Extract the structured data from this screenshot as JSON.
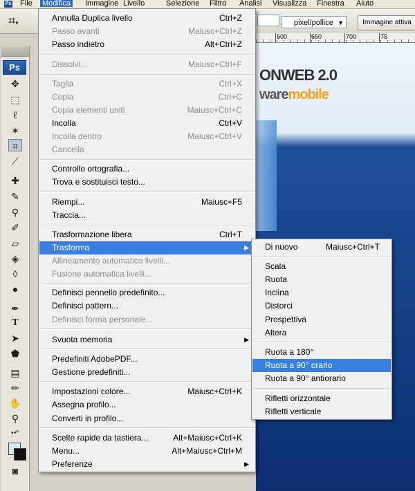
{
  "menubar": {
    "items": [
      "File",
      "Modifica",
      "Immagine",
      "Livello",
      "Selezione",
      "Filtro",
      "Analisi",
      "Visualizza",
      "Finestra",
      "Aiuto"
    ],
    "active_index": 1
  },
  "options_bar": {
    "unit_select_value": "pixel/pollice",
    "front_image_button": "Immagine attiva"
  },
  "ruler": {
    "ticks": [
      "600",
      "650",
      "700",
      "75"
    ]
  },
  "toolbox": {
    "logo": "Ps"
  },
  "canvas": {
    "brand_line1": "ONWEB 2.0",
    "brand_line2_a": "ware",
    "brand_line2_b": "mobile"
  },
  "edit_menu": {
    "items": [
      {
        "label": "Annulla Duplica livello",
        "shortcut": "Ctrl+Z",
        "enabled": true
      },
      {
        "label": "Passo avanti",
        "shortcut": "Maiusc+Ctrl+Z",
        "enabled": false
      },
      {
        "label": "Passo indietro",
        "shortcut": "Alt+Ctrl+Z",
        "enabled": true
      },
      {
        "label": "Dissolvi...",
        "shortcut": "Maiusc+Ctrl+F",
        "enabled": false
      },
      {
        "label": "Taglia",
        "shortcut": "Ctrl+X",
        "enabled": false
      },
      {
        "label": "Copia",
        "shortcut": "Ctrl+C",
        "enabled": false
      },
      {
        "label": "Copia elementi uniti",
        "shortcut": "Maiusc+Ctrl+C",
        "enabled": false
      },
      {
        "label": "Incolla",
        "shortcut": "Ctrl+V",
        "enabled": true
      },
      {
        "label": "Incolla dentro",
        "shortcut": "Maiusc+Ctrl+V",
        "enabled": false
      },
      {
        "label": "Cancella",
        "shortcut": "",
        "enabled": false
      },
      {
        "label": "Controllo ortografia...",
        "shortcut": "",
        "enabled": true
      },
      {
        "label": "Trova e sostituisci testo...",
        "shortcut": "",
        "enabled": true
      },
      {
        "label": "Riempi...",
        "shortcut": "Maiusc+F5",
        "enabled": true
      },
      {
        "label": "Traccia...",
        "shortcut": "",
        "enabled": true
      },
      {
        "label": "Trasformazione libera",
        "shortcut": "Ctrl+T",
        "enabled": true
      },
      {
        "label": "Trasforma",
        "shortcut": "",
        "enabled": true,
        "submenu": true,
        "highlighted": true
      },
      {
        "label": "Allineamento automatico livelli...",
        "shortcut": "",
        "enabled": false
      },
      {
        "label": "Fusione automatica livelli...",
        "shortcut": "",
        "enabled": false
      },
      {
        "label": "Definisci pennello predefinito...",
        "shortcut": "",
        "enabled": true
      },
      {
        "label": "Definisci pattern...",
        "shortcut": "",
        "enabled": true
      },
      {
        "label": "Definisci forma personale...",
        "shortcut": "",
        "enabled": false
      },
      {
        "label": "Svuota memoria",
        "shortcut": "",
        "enabled": true,
        "submenu": true
      },
      {
        "label": "Predefiniti AdobePDF...",
        "shortcut": "",
        "enabled": true
      },
      {
        "label": "Gestione predefiniti...",
        "shortcut": "",
        "enabled": true
      },
      {
        "label": "Impostazioni colore...",
        "shortcut": "Maiusc+Ctrl+K",
        "enabled": true
      },
      {
        "label": "Assegna profilo...",
        "shortcut": "",
        "enabled": true
      },
      {
        "label": "Converti in profilo...",
        "shortcut": "",
        "enabled": true
      },
      {
        "label": "Scelte rapide da tastiera...",
        "shortcut": "Alt+Maiusc+Ctrl+K",
        "enabled": true
      },
      {
        "label": "Menu...",
        "shortcut": "Alt+Maiusc+Ctrl+M",
        "enabled": true
      },
      {
        "label": "Preferenze",
        "shortcut": "",
        "enabled": true,
        "submenu": true
      }
    ]
  },
  "transform_submenu": {
    "items": [
      {
        "label": "Di nuovo",
        "shortcut": "Maiusc+Ctrl+T"
      },
      {
        "label": "Scala",
        "shortcut": ""
      },
      {
        "label": "Ruota",
        "shortcut": ""
      },
      {
        "label": "Inclina",
        "shortcut": ""
      },
      {
        "label": "Distorci",
        "shortcut": ""
      },
      {
        "label": "Prospettiva",
        "shortcut": ""
      },
      {
        "label": "Altera",
        "shortcut": ""
      },
      {
        "label": "Ruota a 180°",
        "shortcut": ""
      },
      {
        "label": "Ruota a 90° orario",
        "shortcut": "",
        "highlighted": true
      },
      {
        "label": "Ruota a 90° antiorario",
        "shortcut": ""
      },
      {
        "label": "Rifletti orizzontale",
        "shortcut": ""
      },
      {
        "label": "Rifletti verticale",
        "shortcut": ""
      }
    ]
  },
  "colors": {
    "highlight": "#3a7fe0",
    "menu_bg": "#f0f0f0",
    "disabled_text": "#8d8d8d"
  }
}
